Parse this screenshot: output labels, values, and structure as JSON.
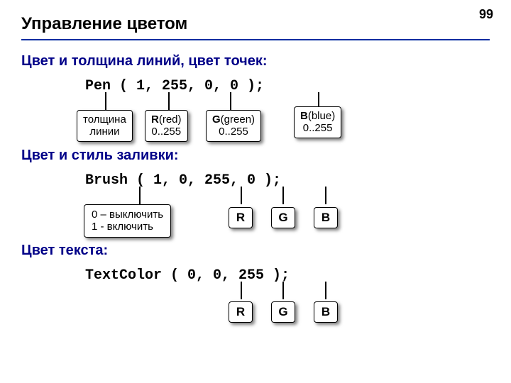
{
  "page_number": "99",
  "title": "Управление цветом",
  "section1": "Цвет и толщина линий, цвет точек:",
  "code1": "Pen ( 1, 255, 0, 0 );",
  "callout_thickness": "толщина\nлинии",
  "callout_r_label_b": "R",
  "callout_r_label_rest": "(red)",
  "callout_r_range": "0..255",
  "callout_g_label_b": "G",
  "callout_g_label_rest": "(green)",
  "callout_g_range": "0..255",
  "callout_b_label_b": "B",
  "callout_b_label_rest": "(blue)",
  "callout_b_range": "0..255",
  "section2": "Цвет и стиль заливки:",
  "code2": "Brush ( 1, 0, 255, 0 );",
  "callout_switch_l1": "0 – выключить",
  "callout_switch_l2": "1 - включить",
  "badge_r": "R",
  "badge_g": "G",
  "badge_b": "B",
  "section3": "Цвет текста:",
  "code3": "TextColor ( 0, 0, 255 );"
}
